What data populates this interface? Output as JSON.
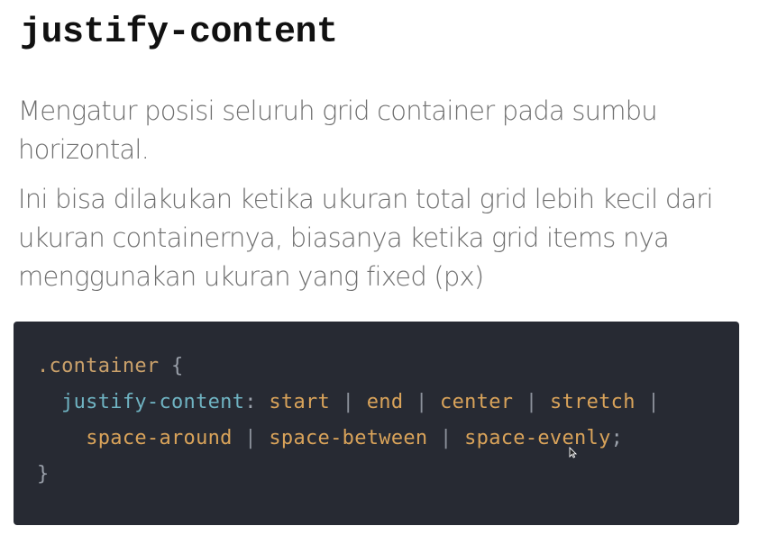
{
  "heading": "justify-content",
  "paragraph1": "Mengatur posisi seluruh grid container pada sumbu horizontal.",
  "paragraph2": "Ini bisa dilakukan ketika ukuran total grid lebih kecil dari ukuran containernya, biasanya ketika grid items nya menggunakan ukuran yang fixed (px)",
  "code": {
    "selector": ".container",
    "open_brace": "{",
    "close_brace": "}",
    "property": "justify-content",
    "colon": ":",
    "separator": "|",
    "terminator": ";",
    "values_line1": [
      "start",
      "end",
      "center",
      "stretch"
    ],
    "values_line2": [
      "space-around",
      "space-between",
      "space-evenly"
    ]
  },
  "colors": {
    "code_background": "#272a33",
    "property": "#6fb3c2",
    "value": "#d9a35a"
  }
}
